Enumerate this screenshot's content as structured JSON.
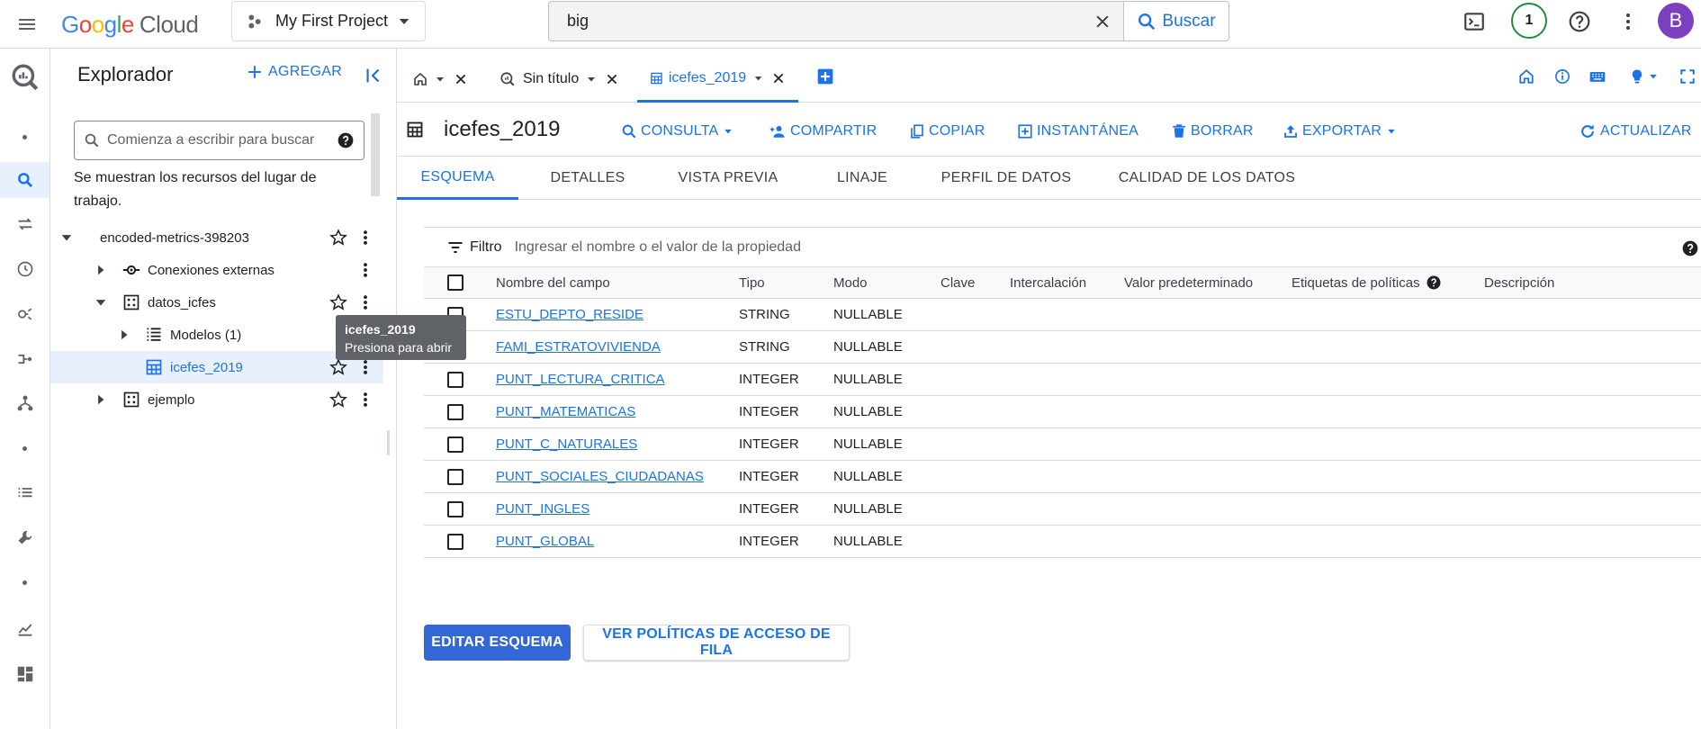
{
  "topbar": {
    "logo_google": "Google",
    "logo_cloud": "Cloud",
    "project_name": "My First Project",
    "search_value": "big",
    "search_button": "Buscar",
    "notifications_count": "1",
    "avatar_letter": "B"
  },
  "explorer": {
    "title": "Explorador",
    "add_label": "AGREGAR",
    "search_placeholder": "Comienza a escribir para buscar",
    "note": "Se muestran los recursos del lugar de trabajo.",
    "tree": {
      "project": "encoded-metrics-398203",
      "external": "Conexiones externas",
      "dataset1": "datos_icfes",
      "models": "Modelos (1)",
      "table": "icefes_2019",
      "dataset2": "ejemplo"
    },
    "tooltip": {
      "title": "icefes_2019",
      "text": "Presiona para abrir"
    }
  },
  "tabs": {
    "untitled": "Sin título",
    "table": "icefes_2019"
  },
  "header": {
    "title": "icefes_2019",
    "actions": {
      "query": "CONSULTA",
      "share": "COMPARTIR",
      "copy": "COPIAR",
      "snapshot": "INSTANTÁNEA",
      "delete": "BORRAR",
      "export": "EXPORTAR",
      "refresh": "ACTUALIZAR"
    }
  },
  "subtabs": {
    "schema": "ESQUEMA",
    "details": "DETALLES",
    "preview": "VISTA PREVIA",
    "lineage": "LINAJE",
    "profile": "PERFIL DE DATOS",
    "quality": "CALIDAD DE LOS DATOS"
  },
  "filter": {
    "label": "Filtro",
    "placeholder": "Ingresar el nombre o el valor de la propiedad"
  },
  "schema": {
    "headers": {
      "name": "Nombre del campo",
      "type": "Tipo",
      "mode": "Modo",
      "key": "Clave",
      "collation": "Intercalación",
      "default": "Valor predeterminado",
      "policy": "Etiquetas de políticas",
      "description": "Descripción"
    },
    "rows": [
      {
        "name": "ESTU_DEPTO_RESIDE",
        "type": "STRING",
        "mode": "NULLABLE"
      },
      {
        "name": "FAMI_ESTRATOVIVIENDA",
        "type": "STRING",
        "mode": "NULLABLE"
      },
      {
        "name": "PUNT_LECTURA_CRITICA",
        "type": "INTEGER",
        "mode": "NULLABLE"
      },
      {
        "name": "PUNT_MATEMATICAS",
        "type": "INTEGER",
        "mode": "NULLABLE"
      },
      {
        "name": "PUNT_C_NATURALES",
        "type": "INTEGER",
        "mode": "NULLABLE"
      },
      {
        "name": "PUNT_SOCIALES_CIUDADANAS",
        "type": "INTEGER",
        "mode": "NULLABLE"
      },
      {
        "name": "PUNT_INGLES",
        "type": "INTEGER",
        "mode": "NULLABLE"
      },
      {
        "name": "PUNT_GLOBAL",
        "type": "INTEGER",
        "mode": "NULLABLE"
      }
    ]
  },
  "buttons": {
    "edit_schema": "EDITAR ESQUEMA",
    "row_policies": "VER POLÍTICAS DE ACCESO DE FILA"
  }
}
